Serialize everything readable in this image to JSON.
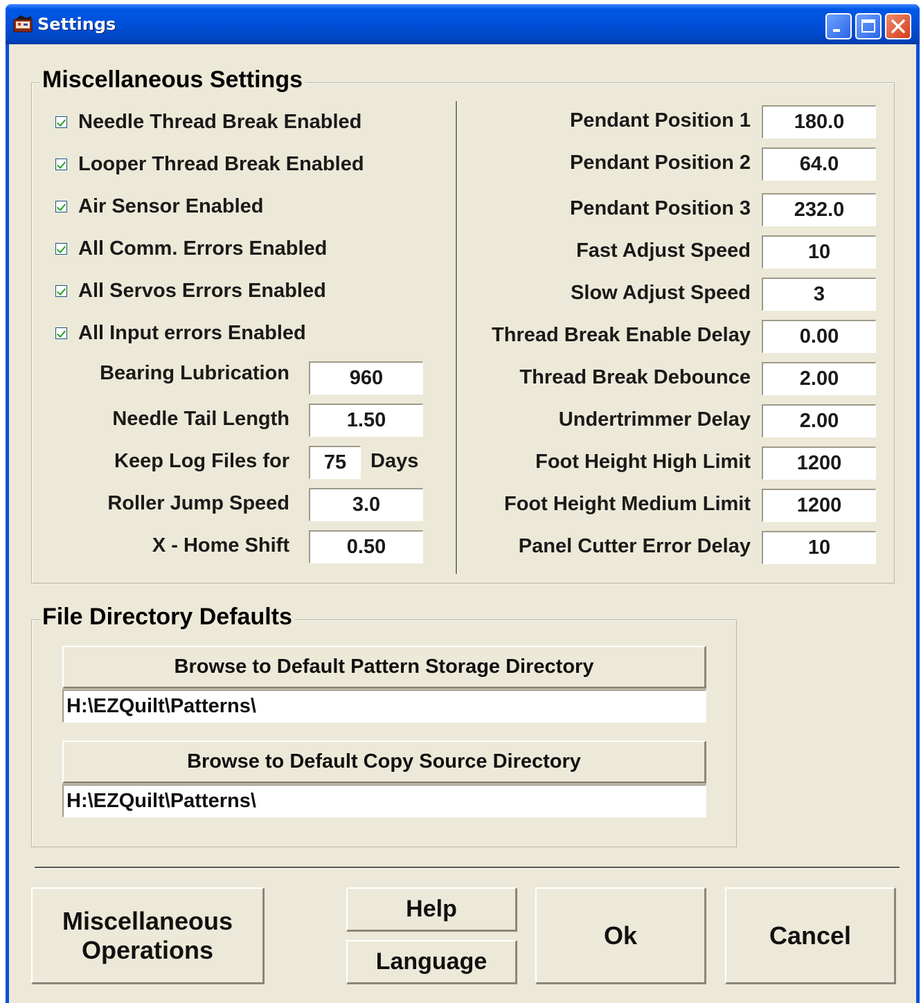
{
  "window": {
    "title": "Settings"
  },
  "misc": {
    "group_title": "Miscellaneous Settings",
    "checkboxes": [
      {
        "label": "Needle Thread Break Enabled",
        "checked": true
      },
      {
        "label": "Looper Thread Break Enabled",
        "checked": true
      },
      {
        "label": "Air Sensor Enabled",
        "checked": true
      },
      {
        "label": "All Comm. Errors Enabled",
        "checked": true
      },
      {
        "label": "All Servos Errors Enabled",
        "checked": true
      },
      {
        "label": "All Input errors Enabled",
        "checked": true
      }
    ],
    "left_fields": [
      {
        "label": "Bearing Lubrication",
        "value": "960"
      },
      {
        "label": "Needle Tail Length",
        "value": "1.50"
      },
      {
        "label": "Keep Log Files for",
        "value": "75",
        "suffix": "Days"
      },
      {
        "label": "Roller Jump Speed",
        "value": "3.0"
      },
      {
        "label": "X - Home Shift",
        "value": "0.50"
      }
    ],
    "right_fields": [
      {
        "label": "Pendant Position 1",
        "value": "180.0"
      },
      {
        "label": "Pendant Position 2",
        "value": "64.0"
      },
      {
        "label": "Pendant Position 3",
        "value": "232.0"
      },
      {
        "label": "Fast Adjust Speed",
        "value": "10"
      },
      {
        "label": "Slow Adjust Speed",
        "value": "3"
      },
      {
        "label": "Thread Break Enable Delay",
        "value": "0.00"
      },
      {
        "label": "Thread Break Debounce",
        "value": "2.00"
      },
      {
        "label": "Undertrimmer Delay",
        "value": "2.00"
      },
      {
        "label": "Foot Height High Limit",
        "value": "1200"
      },
      {
        "label": "Foot Height Medium Limit",
        "value": "1200"
      },
      {
        "label": "Panel Cutter Error Delay",
        "value": "10"
      }
    ]
  },
  "files": {
    "group_title": "File Directory Defaults",
    "pattern_button": "Browse to Default Pattern Storage Directory",
    "pattern_path": "H:\\EZQuilt\\Patterns\\",
    "copy_button": "Browse to Default Copy Source Directory",
    "copy_path": "H:\\EZQuilt\\Patterns\\"
  },
  "buttons": {
    "misc_ops_line1": "Miscellaneous",
    "misc_ops_line2": "Operations",
    "help": "Help",
    "language": "Language",
    "ok": "Ok",
    "cancel": "Cancel"
  }
}
